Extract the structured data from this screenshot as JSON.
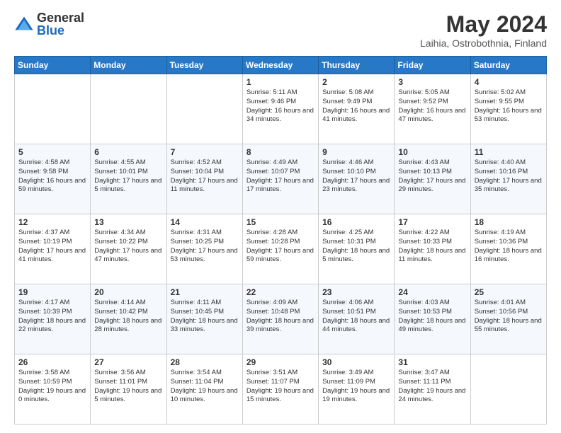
{
  "header": {
    "logo_general": "General",
    "logo_blue": "Blue",
    "month_title": "May 2024",
    "location": "Laihia, Ostrobothnia, Finland"
  },
  "days_of_week": [
    "Sunday",
    "Monday",
    "Tuesday",
    "Wednesday",
    "Thursday",
    "Friday",
    "Saturday"
  ],
  "weeks": [
    [
      {
        "day": "",
        "info": ""
      },
      {
        "day": "",
        "info": ""
      },
      {
        "day": "",
        "info": ""
      },
      {
        "day": "1",
        "info": "Sunrise: 5:11 AM\nSunset: 9:46 PM\nDaylight: 16 hours and 34 minutes."
      },
      {
        "day": "2",
        "info": "Sunrise: 5:08 AM\nSunset: 9:49 PM\nDaylight: 16 hours and 41 minutes."
      },
      {
        "day": "3",
        "info": "Sunrise: 5:05 AM\nSunset: 9:52 PM\nDaylight: 16 hours and 47 minutes."
      },
      {
        "day": "4",
        "info": "Sunrise: 5:02 AM\nSunset: 9:55 PM\nDaylight: 16 hours and 53 minutes."
      }
    ],
    [
      {
        "day": "5",
        "info": "Sunrise: 4:58 AM\nSunset: 9:58 PM\nDaylight: 16 hours and 59 minutes."
      },
      {
        "day": "6",
        "info": "Sunrise: 4:55 AM\nSunset: 10:01 PM\nDaylight: 17 hours and 5 minutes."
      },
      {
        "day": "7",
        "info": "Sunrise: 4:52 AM\nSunset: 10:04 PM\nDaylight: 17 hours and 11 minutes."
      },
      {
        "day": "8",
        "info": "Sunrise: 4:49 AM\nSunset: 10:07 PM\nDaylight: 17 hours and 17 minutes."
      },
      {
        "day": "9",
        "info": "Sunrise: 4:46 AM\nSunset: 10:10 PM\nDaylight: 17 hours and 23 minutes."
      },
      {
        "day": "10",
        "info": "Sunrise: 4:43 AM\nSunset: 10:13 PM\nDaylight: 17 hours and 29 minutes."
      },
      {
        "day": "11",
        "info": "Sunrise: 4:40 AM\nSunset: 10:16 PM\nDaylight: 17 hours and 35 minutes."
      }
    ],
    [
      {
        "day": "12",
        "info": "Sunrise: 4:37 AM\nSunset: 10:19 PM\nDaylight: 17 hours and 41 minutes."
      },
      {
        "day": "13",
        "info": "Sunrise: 4:34 AM\nSunset: 10:22 PM\nDaylight: 17 hours and 47 minutes."
      },
      {
        "day": "14",
        "info": "Sunrise: 4:31 AM\nSunset: 10:25 PM\nDaylight: 17 hours and 53 minutes."
      },
      {
        "day": "15",
        "info": "Sunrise: 4:28 AM\nSunset: 10:28 PM\nDaylight: 17 hours and 59 minutes."
      },
      {
        "day": "16",
        "info": "Sunrise: 4:25 AM\nSunset: 10:31 PM\nDaylight: 18 hours and 5 minutes."
      },
      {
        "day": "17",
        "info": "Sunrise: 4:22 AM\nSunset: 10:33 PM\nDaylight: 18 hours and 11 minutes."
      },
      {
        "day": "18",
        "info": "Sunrise: 4:19 AM\nSunset: 10:36 PM\nDaylight: 18 hours and 16 minutes."
      }
    ],
    [
      {
        "day": "19",
        "info": "Sunrise: 4:17 AM\nSunset: 10:39 PM\nDaylight: 18 hours and 22 minutes."
      },
      {
        "day": "20",
        "info": "Sunrise: 4:14 AM\nSunset: 10:42 PM\nDaylight: 18 hours and 28 minutes."
      },
      {
        "day": "21",
        "info": "Sunrise: 4:11 AM\nSunset: 10:45 PM\nDaylight: 18 hours and 33 minutes."
      },
      {
        "day": "22",
        "info": "Sunrise: 4:09 AM\nSunset: 10:48 PM\nDaylight: 18 hours and 39 minutes."
      },
      {
        "day": "23",
        "info": "Sunrise: 4:06 AM\nSunset: 10:51 PM\nDaylight: 18 hours and 44 minutes."
      },
      {
        "day": "24",
        "info": "Sunrise: 4:03 AM\nSunset: 10:53 PM\nDaylight: 18 hours and 49 minutes."
      },
      {
        "day": "25",
        "info": "Sunrise: 4:01 AM\nSunset: 10:56 PM\nDaylight: 18 hours and 55 minutes."
      }
    ],
    [
      {
        "day": "26",
        "info": "Sunrise: 3:58 AM\nSunset: 10:59 PM\nDaylight: 19 hours and 0 minutes."
      },
      {
        "day": "27",
        "info": "Sunrise: 3:56 AM\nSunset: 11:01 PM\nDaylight: 19 hours and 5 minutes."
      },
      {
        "day": "28",
        "info": "Sunrise: 3:54 AM\nSunset: 11:04 PM\nDaylight: 19 hours and 10 minutes."
      },
      {
        "day": "29",
        "info": "Sunrise: 3:51 AM\nSunset: 11:07 PM\nDaylight: 19 hours and 15 minutes."
      },
      {
        "day": "30",
        "info": "Sunrise: 3:49 AM\nSunset: 11:09 PM\nDaylight: 19 hours and 19 minutes."
      },
      {
        "day": "31",
        "info": "Sunrise: 3:47 AM\nSunset: 11:11 PM\nDaylight: 19 hours and 24 minutes."
      },
      {
        "day": "",
        "info": ""
      }
    ]
  ]
}
